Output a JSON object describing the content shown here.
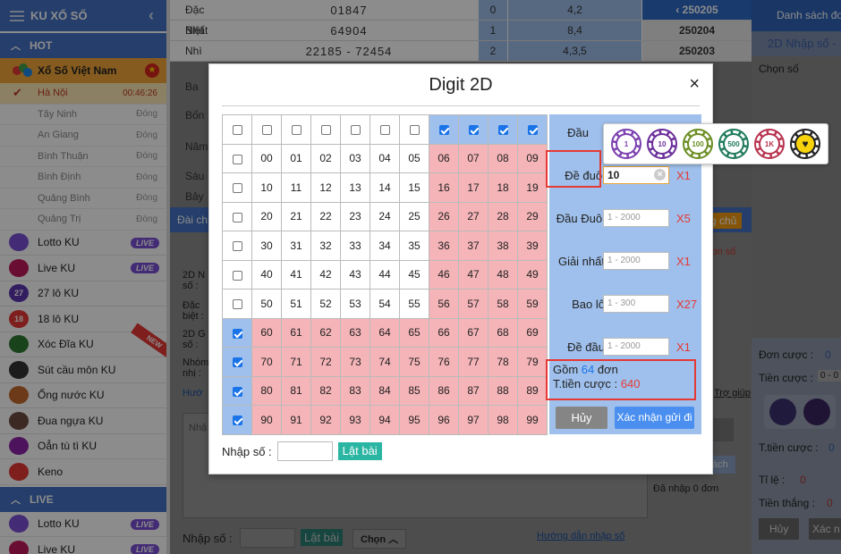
{
  "sidebar": {
    "title": "KU XỔ SỐ",
    "hot_label": "HOT",
    "category": "Xổ Số Việt Nam",
    "cities": [
      {
        "name": "Hà Nội",
        "status": "00:46:26",
        "active": true
      },
      {
        "name": "Tây Ninh",
        "status": "Đóng"
      },
      {
        "name": "An Giang",
        "status": "Đóng"
      },
      {
        "name": "Bình Thuận",
        "status": "Đóng"
      },
      {
        "name": "Bình Định",
        "status": "Đóng"
      },
      {
        "name": "Quảng Bình",
        "status": "Đóng"
      },
      {
        "name": "Quảng Trị",
        "status": "Đóng"
      }
    ],
    "games": [
      {
        "name": "Lotto KU",
        "badge": "LIVE"
      },
      {
        "name": "Live KU",
        "badge": "LIVE"
      },
      {
        "name": "27 lô KU",
        "icon_text": "27"
      },
      {
        "name": "18 lô KU",
        "icon_text": "18"
      },
      {
        "name": "Xóc Đĩa KU",
        "ribbon": "NEW"
      },
      {
        "name": "Sút cầu môn KU"
      },
      {
        "name": "Ống nước KU"
      },
      {
        "name": "Đua ngựa KU"
      },
      {
        "name": "Oẳn tù tì KU"
      },
      {
        "name": "Keno"
      }
    ],
    "live_label": "LIVE",
    "live_games": [
      {
        "name": "Lotto KU",
        "badge": "LIVE"
      },
      {
        "name": "Live KU",
        "badge": "LIVE"
      }
    ]
  },
  "results": {
    "rows": [
      {
        "label": "Đặc Biệt",
        "number": "01847",
        "index": "0",
        "value": "4,2",
        "date": "250205",
        "selected": true
      },
      {
        "label": "Nhất",
        "number": "64904",
        "index": "1",
        "value": "8,4",
        "date": "250204"
      },
      {
        "label": "Nhì",
        "number": "22185 - 72454",
        "index": "2",
        "value": "4,3,5",
        "date": "250203"
      }
    ],
    "more_labels": [
      "Ba",
      "Bốn",
      "Năm",
      "Sáu",
      "Bảy"
    ]
  },
  "background": {
    "tab_label": "Đài chí",
    "orange_label": "g chủ",
    "con_so": "con số",
    "form_labels": [
      "2D N",
      "số :",
      "Đặc",
      "biệt :",
      "2D G",
      "số :",
      "Nhóm",
      "nhị :",
      "Hướ"
    ],
    "textarea_placeholder": "Nhậ",
    "bottom_nhap": "Nhập số :",
    "bottom_lat": "Lật bài",
    "bottom_chon": "Chọn",
    "bottom_guide": "Hướng dẫn nhập số",
    "tro_giup": "Trợ giúp",
    "da_nhap": "Đã nhập 0 đơn",
    "ach": "ách"
  },
  "right_panel": {
    "header": "Danh sách đơ",
    "sub": "2D Nhập số -",
    "chon_so": "Chọn số",
    "don_cuoc": "Đơn cược :",
    "don_cuoc_val": "0",
    "tien_cuoc": "Tiền cược :",
    "tien_cuoc_val": "0 - 0",
    "t_tien_cuoc": "T.tiền cược :",
    "t_tien_cuoc_val": "0",
    "ti_le": "Tỉ lệ :",
    "ti_le_val": "0",
    "tien_thang": "Tiền thắng :",
    "tien_thang_val": "0",
    "huy": "Hủy",
    "xac": "Xác n"
  },
  "modal": {
    "title": "Digit 2D",
    "close": "×",
    "numbers_rows": [
      [
        "00",
        "01",
        "02",
        "03",
        "04",
        "05",
        "06",
        "07",
        "08",
        "09"
      ],
      [
        "10",
        "11",
        "12",
        "13",
        "14",
        "15",
        "16",
        "17",
        "18",
        "19"
      ],
      [
        "20",
        "21",
        "22",
        "23",
        "24",
        "25",
        "26",
        "27",
        "28",
        "29"
      ],
      [
        "30",
        "31",
        "32",
        "33",
        "34",
        "35",
        "36",
        "37",
        "38",
        "39"
      ],
      [
        "40",
        "41",
        "42",
        "43",
        "44",
        "45",
        "46",
        "47",
        "48",
        "49"
      ],
      [
        "50",
        "51",
        "52",
        "53",
        "54",
        "55",
        "56",
        "57",
        "58",
        "59"
      ],
      [
        "60",
        "61",
        "62",
        "63",
        "64",
        "65",
        "66",
        "67",
        "68",
        "69"
      ],
      [
        "70",
        "71",
        "72",
        "73",
        "74",
        "75",
        "76",
        "77",
        "78",
        "79"
      ],
      [
        "80",
        "81",
        "82",
        "83",
        "84",
        "85",
        "86",
        "87",
        "88",
        "89"
      ],
      [
        "90",
        "91",
        "92",
        "93",
        "94",
        "95",
        "96",
        "97",
        "98",
        "99"
      ]
    ],
    "column_checks": [
      false,
      false,
      false,
      false,
      false,
      false,
      true,
      true,
      true,
      true
    ],
    "row_checks": [
      false,
      false,
      false,
      false,
      false,
      false,
      true,
      true,
      true,
      true
    ],
    "bets": [
      {
        "label": "Đầu",
        "value": "",
        "placeholder": "",
        "mult": ""
      },
      {
        "label": "Đề đuôi",
        "value": "10",
        "placeholder": "",
        "mult": "X1"
      },
      {
        "label": "Đầu Đuôi",
        "value": "",
        "placeholder": "1 - 2000",
        "mult": "X5"
      },
      {
        "label": "Giải nhất",
        "value": "",
        "placeholder": "1 - 2000",
        "mult": "X1"
      },
      {
        "label": "Bao lô",
        "value": "",
        "placeholder": "1 - 300",
        "mult": "X27"
      },
      {
        "label": "Đề đầu",
        "value": "",
        "placeholder": "1 - 2000",
        "mult": "X1"
      }
    ],
    "summary_prefix": "Gồm",
    "summary_count": "64",
    "summary_unit": "đơn",
    "summary_total_label": "T.tiền cược :",
    "summary_total": "640",
    "cancel": "Hủy",
    "confirm": "Xác nhận gửi đi",
    "entry_label": "Nhập số :",
    "entry_button": "Lật bài"
  },
  "chips": [
    {
      "label": "1",
      "color": "#7b3fb0"
    },
    {
      "label": "10",
      "color": "#6a2d9a"
    },
    {
      "label": "100",
      "color": "#6b8e23"
    },
    {
      "label": "500",
      "color": "#1f7a5a"
    },
    {
      "label": "1K",
      "color": "#b8324f"
    },
    {
      "label": "♥",
      "color": "#222222"
    }
  ]
}
